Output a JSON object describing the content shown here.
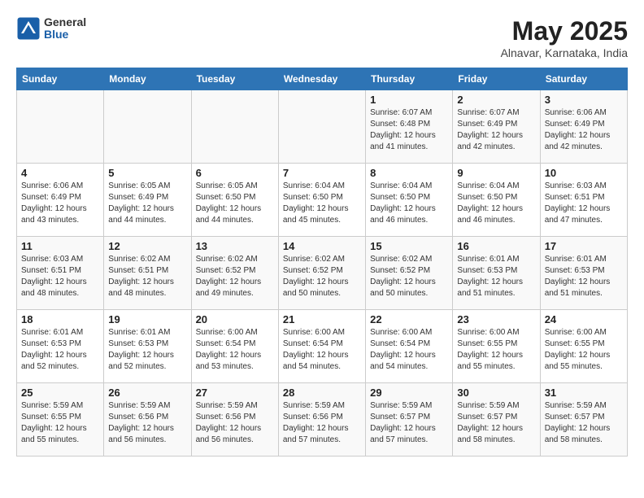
{
  "header": {
    "logo_general": "General",
    "logo_blue": "Blue",
    "title": "May 2025",
    "location": "Alnavar, Karnataka, India"
  },
  "days_of_week": [
    "Sunday",
    "Monday",
    "Tuesday",
    "Wednesday",
    "Thursday",
    "Friday",
    "Saturday"
  ],
  "weeks": [
    [
      {
        "day": "",
        "info": ""
      },
      {
        "day": "",
        "info": ""
      },
      {
        "day": "",
        "info": ""
      },
      {
        "day": "",
        "info": ""
      },
      {
        "day": "1",
        "info": "Sunrise: 6:07 AM\nSunset: 6:48 PM\nDaylight: 12 hours\nand 41 minutes."
      },
      {
        "day": "2",
        "info": "Sunrise: 6:07 AM\nSunset: 6:49 PM\nDaylight: 12 hours\nand 42 minutes."
      },
      {
        "day": "3",
        "info": "Sunrise: 6:06 AM\nSunset: 6:49 PM\nDaylight: 12 hours\nand 42 minutes."
      }
    ],
    [
      {
        "day": "4",
        "info": "Sunrise: 6:06 AM\nSunset: 6:49 PM\nDaylight: 12 hours\nand 43 minutes."
      },
      {
        "day": "5",
        "info": "Sunrise: 6:05 AM\nSunset: 6:49 PM\nDaylight: 12 hours\nand 44 minutes."
      },
      {
        "day": "6",
        "info": "Sunrise: 6:05 AM\nSunset: 6:50 PM\nDaylight: 12 hours\nand 44 minutes."
      },
      {
        "day": "7",
        "info": "Sunrise: 6:04 AM\nSunset: 6:50 PM\nDaylight: 12 hours\nand 45 minutes."
      },
      {
        "day": "8",
        "info": "Sunrise: 6:04 AM\nSunset: 6:50 PM\nDaylight: 12 hours\nand 46 minutes."
      },
      {
        "day": "9",
        "info": "Sunrise: 6:04 AM\nSunset: 6:50 PM\nDaylight: 12 hours\nand 46 minutes."
      },
      {
        "day": "10",
        "info": "Sunrise: 6:03 AM\nSunset: 6:51 PM\nDaylight: 12 hours\nand 47 minutes."
      }
    ],
    [
      {
        "day": "11",
        "info": "Sunrise: 6:03 AM\nSunset: 6:51 PM\nDaylight: 12 hours\nand 48 minutes."
      },
      {
        "day": "12",
        "info": "Sunrise: 6:02 AM\nSunset: 6:51 PM\nDaylight: 12 hours\nand 48 minutes."
      },
      {
        "day": "13",
        "info": "Sunrise: 6:02 AM\nSunset: 6:52 PM\nDaylight: 12 hours\nand 49 minutes."
      },
      {
        "day": "14",
        "info": "Sunrise: 6:02 AM\nSunset: 6:52 PM\nDaylight: 12 hours\nand 50 minutes."
      },
      {
        "day": "15",
        "info": "Sunrise: 6:02 AM\nSunset: 6:52 PM\nDaylight: 12 hours\nand 50 minutes."
      },
      {
        "day": "16",
        "info": "Sunrise: 6:01 AM\nSunset: 6:53 PM\nDaylight: 12 hours\nand 51 minutes."
      },
      {
        "day": "17",
        "info": "Sunrise: 6:01 AM\nSunset: 6:53 PM\nDaylight: 12 hours\nand 51 minutes."
      }
    ],
    [
      {
        "day": "18",
        "info": "Sunrise: 6:01 AM\nSunset: 6:53 PM\nDaylight: 12 hours\nand 52 minutes."
      },
      {
        "day": "19",
        "info": "Sunrise: 6:01 AM\nSunset: 6:53 PM\nDaylight: 12 hours\nand 52 minutes."
      },
      {
        "day": "20",
        "info": "Sunrise: 6:00 AM\nSunset: 6:54 PM\nDaylight: 12 hours\nand 53 minutes."
      },
      {
        "day": "21",
        "info": "Sunrise: 6:00 AM\nSunset: 6:54 PM\nDaylight: 12 hours\nand 54 minutes."
      },
      {
        "day": "22",
        "info": "Sunrise: 6:00 AM\nSunset: 6:54 PM\nDaylight: 12 hours\nand 54 minutes."
      },
      {
        "day": "23",
        "info": "Sunrise: 6:00 AM\nSunset: 6:55 PM\nDaylight: 12 hours\nand 55 minutes."
      },
      {
        "day": "24",
        "info": "Sunrise: 6:00 AM\nSunset: 6:55 PM\nDaylight: 12 hours\nand 55 minutes."
      }
    ],
    [
      {
        "day": "25",
        "info": "Sunrise: 5:59 AM\nSunset: 6:55 PM\nDaylight: 12 hours\nand 55 minutes."
      },
      {
        "day": "26",
        "info": "Sunrise: 5:59 AM\nSunset: 6:56 PM\nDaylight: 12 hours\nand 56 minutes."
      },
      {
        "day": "27",
        "info": "Sunrise: 5:59 AM\nSunset: 6:56 PM\nDaylight: 12 hours\nand 56 minutes."
      },
      {
        "day": "28",
        "info": "Sunrise: 5:59 AM\nSunset: 6:56 PM\nDaylight: 12 hours\nand 57 minutes."
      },
      {
        "day": "29",
        "info": "Sunrise: 5:59 AM\nSunset: 6:57 PM\nDaylight: 12 hours\nand 57 minutes."
      },
      {
        "day": "30",
        "info": "Sunrise: 5:59 AM\nSunset: 6:57 PM\nDaylight: 12 hours\nand 58 minutes."
      },
      {
        "day": "31",
        "info": "Sunrise: 5:59 AM\nSunset: 6:57 PM\nDaylight: 12 hours\nand 58 minutes."
      }
    ]
  ]
}
